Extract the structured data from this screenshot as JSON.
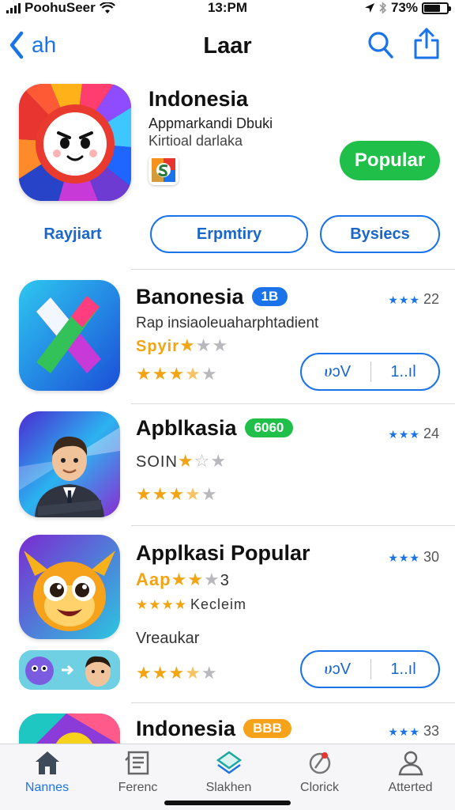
{
  "status_bar": {
    "carrier": "PoohuSeer",
    "time": "13:PM",
    "battery": "73%"
  },
  "nav": {
    "back_label": "ah",
    "title": "Laar"
  },
  "featured": {
    "name": "Indonesia",
    "subtitle_1": "Appmarkandi Dbuki",
    "subtitle_2": "Kirtioal darlaka",
    "action_label": "Popular",
    "chips": [
      "Rayjiart",
      "Erpmtiry",
      "Bysiecs"
    ]
  },
  "apps": [
    {
      "name": "Banonesia",
      "badge": "1B",
      "rank_stars": "★★★",
      "rank": "22",
      "line": "Rap insiaoleuaharphtadient",
      "gold_line": "Spyir",
      "rating_stars": 3.5,
      "action": {
        "left": "ሀↄV",
        "right": "1..ıl"
      }
    },
    {
      "name": "Apblkasia",
      "badge": "6060",
      "rank_stars": "★★★",
      "rank": "24",
      "line": "SOIN",
      "rating_stars": 3.5
    },
    {
      "name": "Applkasi Popular",
      "rank_stars": "★★★",
      "rank": "30",
      "gold_line": "Aap",
      "gold_suffix": "3",
      "kecleim": "Kecleim",
      "vrodukar": "Vreaukar",
      "rating_stars": 3.5,
      "action": {
        "left": "ሀↄV",
        "right": "1..ıl"
      }
    },
    {
      "name": "Indonesia",
      "badge": "BBB",
      "rank_stars": "★★★",
      "rank": "33"
    }
  ],
  "tabs": [
    {
      "label": "Nannes",
      "icon": "home-icon",
      "active": true
    },
    {
      "label": "Ferenc",
      "icon": "news-icon",
      "active": false
    },
    {
      "label": "Slakhen",
      "icon": "layers-icon",
      "active": false
    },
    {
      "label": "Clorick",
      "icon": "rocket-icon",
      "active": false
    },
    {
      "label": "Atterted",
      "icon": "person-icon",
      "active": false
    }
  ],
  "colors": {
    "accent": "#1a73e8",
    "green": "#1fbf4a",
    "gold": "#f2a412"
  }
}
